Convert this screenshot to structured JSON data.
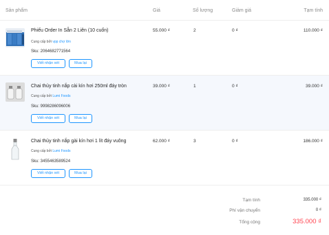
{
  "columns": {
    "product": "Sản phẩm",
    "price": "Giá",
    "quantity": "Số lượng",
    "discount": "Giảm giá",
    "subtotal": "Tạm tính"
  },
  "items": [
    {
      "name": "Phiếu Order In Sẵn 2 Liên (10 cuốn)",
      "supplier_prefix": "Cung cấp bởi ",
      "supplier": "vpp chợ lớn",
      "sku": "Sku: 2064682771564",
      "price": "55.000 ₫",
      "quantity": "2",
      "discount": "0 ₫",
      "subtotal": "110.000 ₫",
      "thumb_icon": "order-book-icon"
    },
    {
      "name": "Chai thủy tinh nắp cài kín hơi 250ml đáy tròn",
      "supplier_prefix": "Cung cấp bởi ",
      "supplier": "Lumi Foods",
      "sku": "Sku: 9998286096006",
      "price": "39.000 ₫",
      "quantity": "1",
      "discount": "0 ₫",
      "subtotal": "39.000 ₫",
      "thumb_icon": "glass-bottles-icon"
    },
    {
      "name": "Chai thủy tinh nắp gài kín hơi 1 lít đáy vuông",
      "supplier_prefix": "Cung cấp bởi ",
      "supplier": "Lumi Foods",
      "sku": "Sku: 3455463589524",
      "price": "62.000 ₫",
      "quantity": "3",
      "discount": "0 ₫",
      "subtotal": "186.000 ₫",
      "thumb_icon": "glass-bottle-icon"
    }
  ],
  "buttons": {
    "review": "Viết nhận xét",
    "rebuy": "Mua lại"
  },
  "summary": {
    "subtotal_label": "Tạm tính",
    "subtotal_value": "335.000 ₫",
    "shipping_label": "Phí vận chuyển",
    "shipping_value": "0 ₫",
    "total_label": "Tổng cộng",
    "total_value": "335.000 ₫"
  },
  "colors": {
    "accent": "#1a94ff",
    "total": "#ff424e",
    "row_highlight": "#f5f8fd"
  }
}
